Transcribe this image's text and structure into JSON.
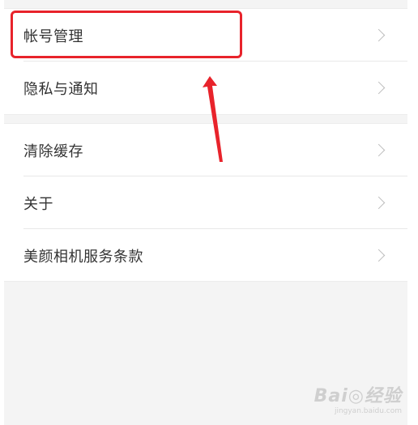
{
  "menu": {
    "group1": [
      {
        "label": "帐号管理"
      },
      {
        "label": "隐私与通知"
      }
    ],
    "group2": [
      {
        "label": "清除缓存"
      },
      {
        "label": "关于"
      },
      {
        "label": "美颜相机服务条款"
      }
    ]
  },
  "annotation": {
    "highlight_color": "#e8232b"
  },
  "watermark": {
    "line1": "Bai◎经验",
    "line2": "jingyan.baidu.com"
  }
}
